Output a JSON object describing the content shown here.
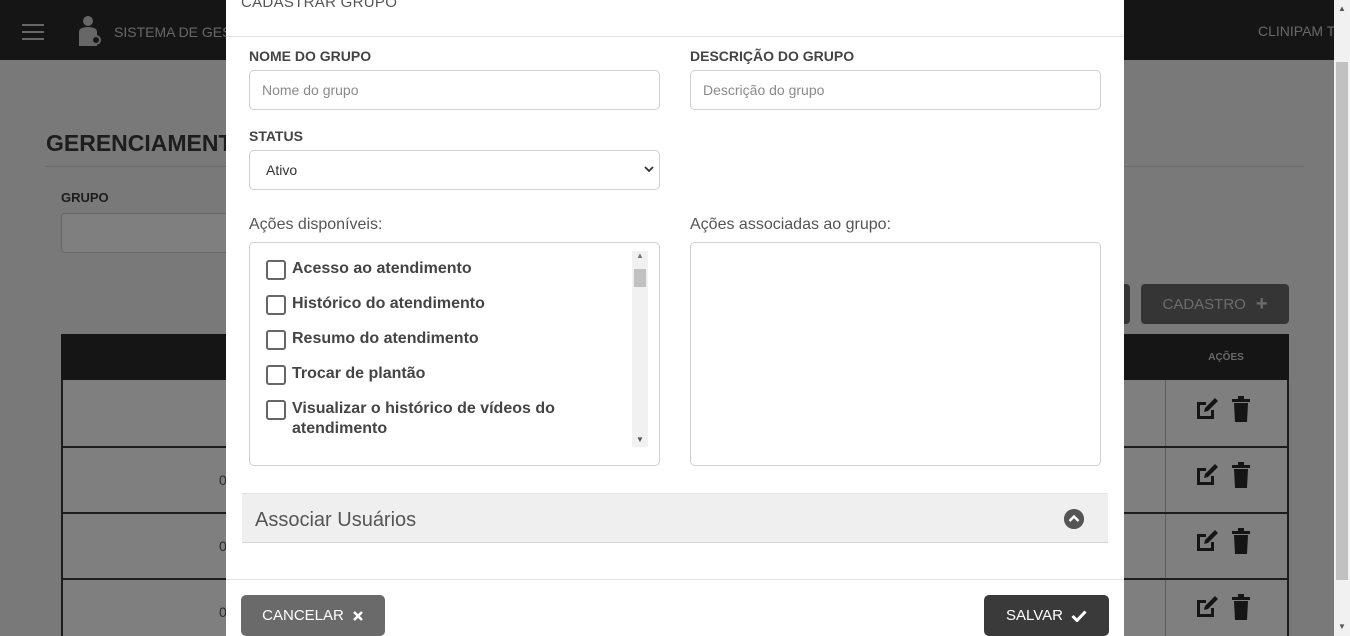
{
  "topbar": {
    "system_title": "SISTEMA DE GEST",
    "org_name": "CLINIPAM T"
  },
  "background": {
    "page_title": "GERENCIAMENT",
    "filter_label": "GRUPO",
    "cadastro_button": "CADASTRO",
    "table_actions_header": "AÇÕES",
    "rows": [
      {
        "num": ""
      },
      {
        "num": "0"
      },
      {
        "num": "0"
      },
      {
        "num": "0"
      }
    ]
  },
  "modal": {
    "title": "CADASTRAR GRUPO",
    "fields": {
      "name_label": "NOME DO GRUPO",
      "name_placeholder": "Nome do grupo",
      "desc_label": "DESCRIÇÃO DO GRUPO",
      "desc_placeholder": "Descrição do grupo",
      "status_label": "STATUS",
      "status_value": "Ativo"
    },
    "available_label": "Ações disponíveis:",
    "associated_label": "Ações associadas ao grupo:",
    "available_actions": [
      {
        "label": "Acesso ao atendimento",
        "checked": false
      },
      {
        "label": "Histórico do atendimento",
        "checked": false
      },
      {
        "label": "Resumo do atendimento",
        "checked": false
      },
      {
        "label": "Trocar de plantão",
        "checked": false
      },
      {
        "label": "Visualizar o histórico de vídeos do atendimento",
        "checked": false
      }
    ],
    "accordion_title": "Associar Usuários",
    "cancel_button": "CANCELAR",
    "save_button": "SALVAR"
  }
}
